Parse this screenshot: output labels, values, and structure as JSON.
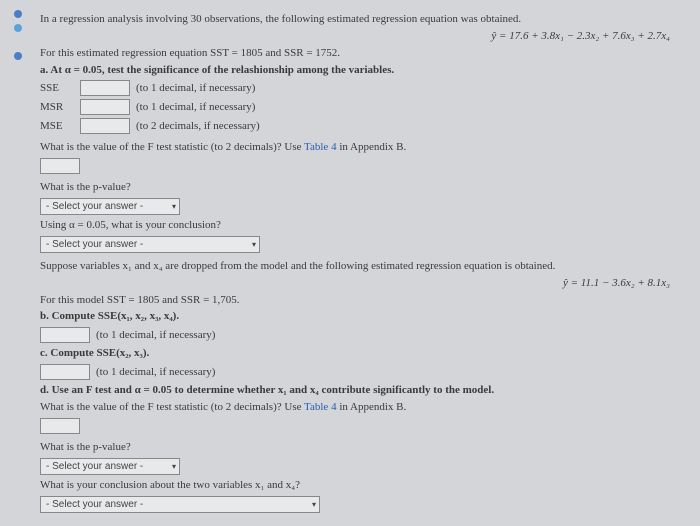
{
  "intro": "In a regression analysis involving 30 observations, the following estimated regression equation was obtained.",
  "eq1": "ŷ = 17.6 + 3.8x₁ − 2.3x₂ + 7.6x₃ + 2.7x₄",
  "for_this": "For this estimated regression equation SST = 1805 and SSR = 1752.",
  "part_a": "a. At α = 0.05, test the significance of the relashionship among the variables.",
  "sse_label": "SSE",
  "msr_label": "MSR",
  "mse_label": "MSE",
  "dec1": "(to 1 decimal, if necessary)",
  "dec2": "(to 2 decimals, if necessary)",
  "f_q": "What is the value of the F test statistic (to 2 decimals)? Use ",
  "table4": "Table 4",
  "appendix": " in Appendix B.",
  "pval_q": "What is the p-value?",
  "select_placeholder": "- Select your answer -",
  "using": "Using α = 0.05, what is your conclusion?",
  "suppose": "Suppose variables x₁ and x₄ are dropped from the model and the following estimated regression equation is obtained.",
  "eq2": "ŷ = 11.1 − 3.6x₂ + 8.1x₃",
  "for_model": "For this model SST = 1805 and SSR = 1,705.",
  "part_b": "b. Compute SSE(x₁, x₂, x₃, x₄).",
  "part_c": "c. Compute SSE(x₂, x₃).",
  "part_d": "d. Use an F test and α = 0.05 to determine whether x₁ and x₄ contribute significantly to the model.",
  "f_q2": "What is the value of the F test statistic (to 2 decimals)? Use ",
  "concl_q": "What is your conclusion about the two variables x₁ and x₄?"
}
